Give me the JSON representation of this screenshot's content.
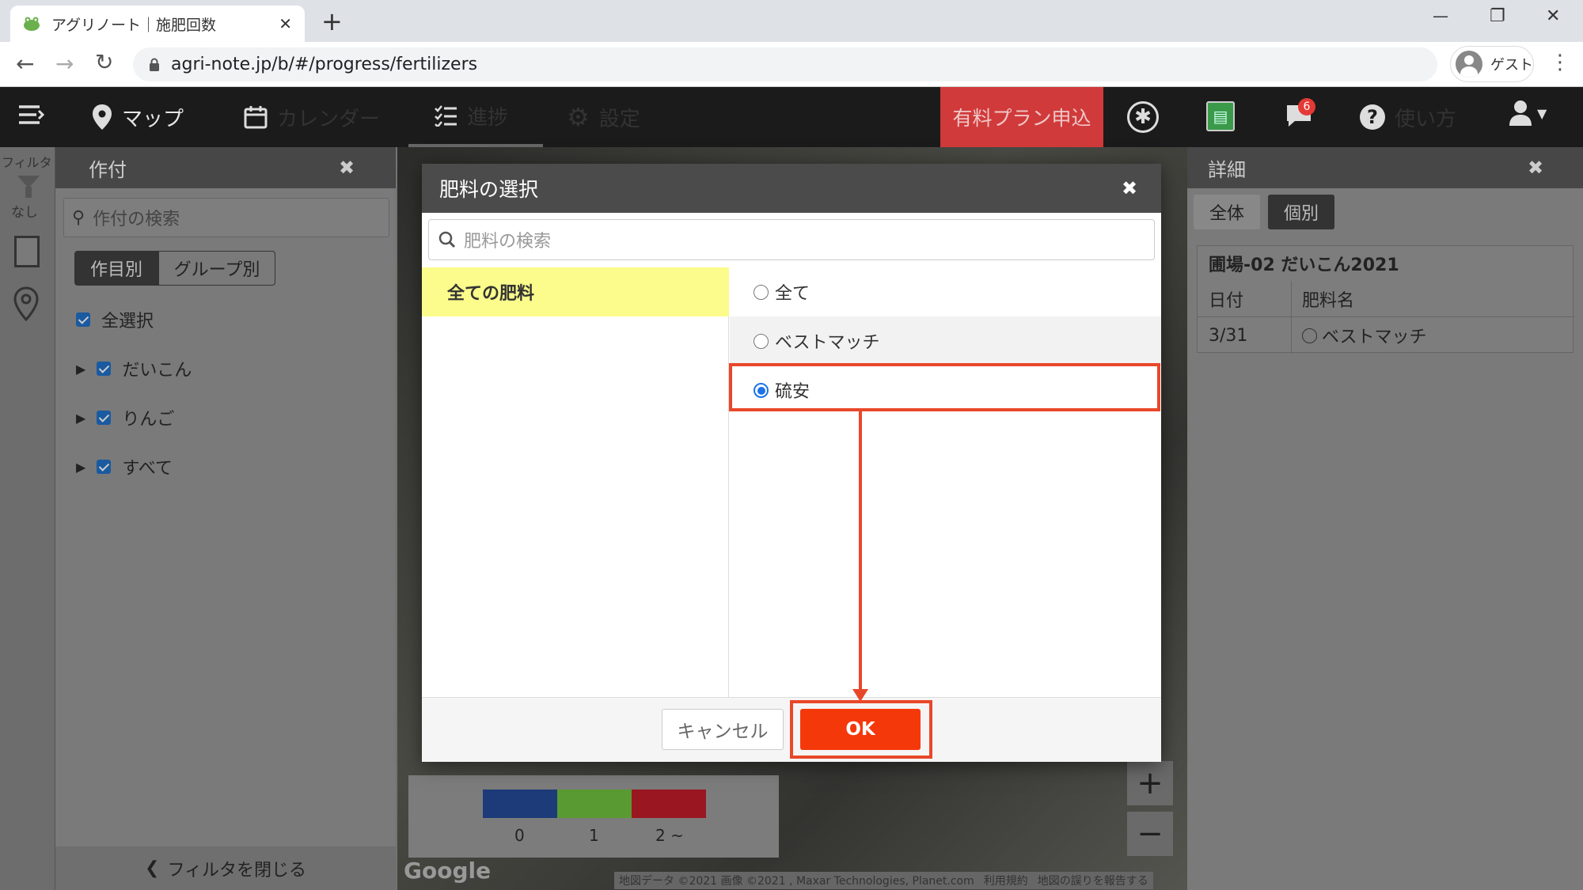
{
  "browser": {
    "tab_title": "アグリノート｜施肥回数",
    "tab_close": "✕",
    "new_tab": "+",
    "url": "agri-note.jp/b/#/progress/fertilizers",
    "guest_label": "ゲスト",
    "window_controls": [
      "—",
      "❐",
      "✕"
    ]
  },
  "nav": {
    "map": "マップ",
    "calendar": "カレンダー",
    "progress": "進捗",
    "settings": "設定",
    "paid_plan": "有料プラン申込",
    "notif_count": "6",
    "help": "使い方"
  },
  "left_strip": {
    "filter_label": "フィルタ",
    "none_label": "なし"
  },
  "filter_panel": {
    "title": "作付",
    "close": "✖",
    "search_placeholder": "作付の検索",
    "toggle_crop": "作目別",
    "toggle_group": "グループ別",
    "select_all": "全選択",
    "items": [
      "だいこん",
      "りんご",
      "すべて"
    ],
    "close_filter": "フィルタを閉じる"
  },
  "detail_panel": {
    "title": "詳細",
    "close": "✖",
    "tab_all": "全体",
    "tab_individual": "個別",
    "field_title": "圃場-02 だいこん2021",
    "col_date": "日付",
    "col_fertilizer": "肥料名",
    "row_date": "3/31",
    "row_fertilizer": "ベストマッチ"
  },
  "map": {
    "legend_labels": [
      "0",
      "1",
      "2 ~"
    ],
    "legend_colors": [
      "#1d3b78",
      "#5a9a32",
      "#9a1620"
    ],
    "zoom_in": "+",
    "zoom_out": "−",
    "google_logo": "Google",
    "attribution": "地図データ ©2021 画像 ©2021 , Maxar Technologies, Planet.com",
    "terms": "利用規約",
    "report": "地図の誤りを報告する"
  },
  "modal": {
    "title": "肥料の選択",
    "close": "✖",
    "search_placeholder": "肥料の検索",
    "category": "全ての肥料",
    "options": [
      {
        "label": "全て",
        "selected": false
      },
      {
        "label": "ベストマッチ",
        "selected": false
      },
      {
        "label": "硫安",
        "selected": true
      }
    ],
    "cancel": "キャンセル",
    "ok": "OK"
  },
  "colors": {
    "accent": "#f5380a",
    "highlight": "#e8482a",
    "category_bg": "#fcfc8c",
    "paid_plan_bg": "#d13a3a"
  }
}
